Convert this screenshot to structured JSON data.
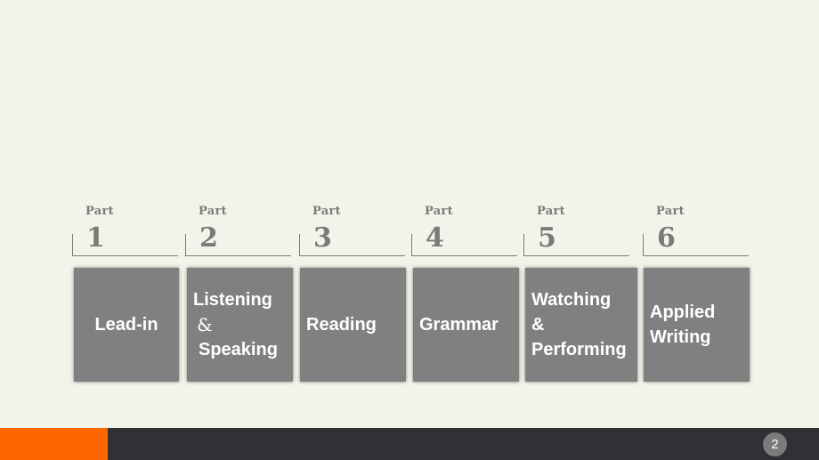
{
  "parts": [
    {
      "label": "Part",
      "number": "1",
      "title_lines": [
        "Lead-in"
      ]
    },
    {
      "label": "Part",
      "number": "2",
      "title_lines": [
        "Listening",
        "&",
        "Speaking"
      ]
    },
    {
      "label": "Part",
      "number": "3",
      "title_lines": [
        "Reading"
      ]
    },
    {
      "label": "Part",
      "number": "4",
      "title_lines": [
        "Grammar"
      ]
    },
    {
      "label": "Part",
      "number": "5",
      "title_lines": [
        "Watching",
        "&",
        "Performing"
      ]
    },
    {
      "label": "Part",
      "number": "6",
      "title_lines": [
        "Applied",
        "Writing"
      ]
    }
  ],
  "footer": {
    "page_number": "2",
    "accent_color": "#ff6600",
    "bar_color": "#323035"
  }
}
